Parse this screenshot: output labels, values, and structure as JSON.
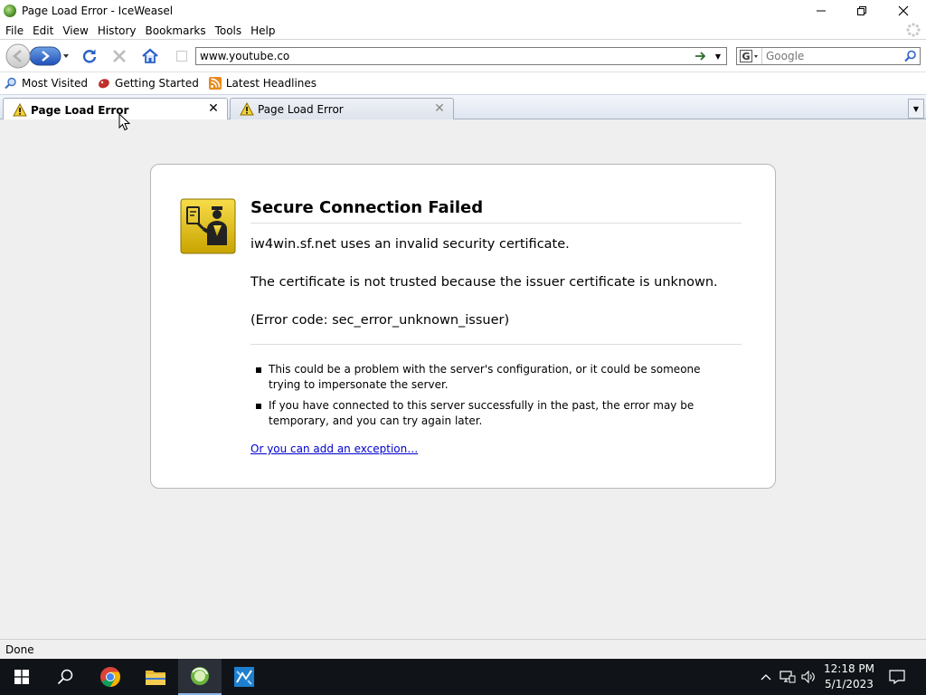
{
  "window": {
    "title": "Page Load Error - IceWeasel"
  },
  "menu": {
    "items": [
      {
        "label": "File"
      },
      {
        "label": "Edit"
      },
      {
        "label": "View"
      },
      {
        "label": "History"
      },
      {
        "label": "Bookmarks"
      },
      {
        "label": "Tools"
      },
      {
        "label": "Help"
      }
    ]
  },
  "navbar": {
    "url": "www.youtube.co",
    "search_placeholder": "Google"
  },
  "bookmarks": {
    "items": [
      {
        "label": "Most Visited",
        "icon": "most-visited-icon"
      },
      {
        "label": "Getting Started",
        "icon": "getting-started-icon"
      },
      {
        "label": "Latest Headlines",
        "icon": "rss-feed-icon"
      }
    ]
  },
  "tabs": [
    {
      "label": "Page Load Error",
      "active": true,
      "icon": "warning-icon"
    },
    {
      "label": "Page Load Error",
      "active": false,
      "icon": "warning-icon"
    }
  ],
  "error": {
    "title": "Secure Connection Failed",
    "line1": "iw4win.sf.net uses an invalid security certificate.",
    "line2": "The certificate is not trusted because the issuer certificate is unknown.",
    "line3": "(Error code: sec_error_unknown_issuer)",
    "bullets": [
      "This could be a problem with the server's configuration, or it could be someone trying to impersonate the server.",
      "If you have connected to this server successfully in the past, the error may be temporary, and you can try again later."
    ],
    "exception_link": "Or you can add an exception…"
  },
  "status": {
    "text": "Done"
  },
  "taskbar": {
    "time": "12:18 PM",
    "date": "5/1/2023",
    "colors": {
      "background": "#101418",
      "active_indicator": "#8cb4e8"
    }
  },
  "colors": {
    "content_background": "#efefef",
    "link": "#0000cc",
    "warning_badge": "#e8c41f"
  }
}
